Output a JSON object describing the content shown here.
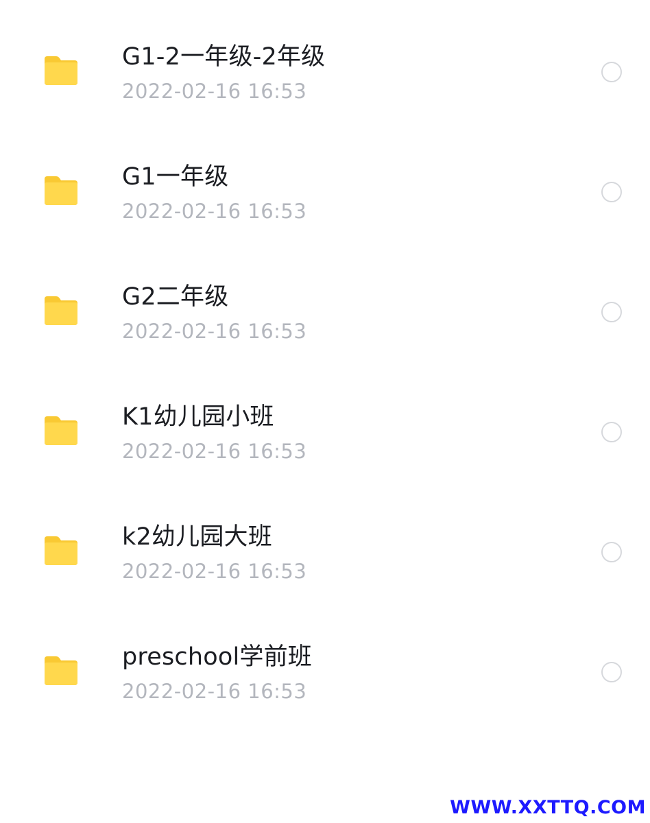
{
  "files": [
    {
      "name": "G1-2一年级-2年级",
      "date": "2022-02-16 16:53",
      "icon": "folder-icon",
      "selected": false
    },
    {
      "name": "G1一年级",
      "date": "2022-02-16 16:53",
      "icon": "folder-icon",
      "selected": false
    },
    {
      "name": "G2二年级",
      "date": "2022-02-16 16:53",
      "icon": "folder-icon",
      "selected": false
    },
    {
      "name": "K1幼儿园小班",
      "date": "2022-02-16 16:53",
      "icon": "folder-icon",
      "selected": false
    },
    {
      "name": "k2幼儿园大班",
      "date": "2022-02-16 16:53",
      "icon": "folder-icon",
      "selected": false
    },
    {
      "name": "preschool学前班",
      "date": "2022-02-16 16:53",
      "icon": "folder-icon",
      "selected": false
    }
  ],
  "watermark": "WWW.XXTTQ.COM",
  "colors": {
    "folder_body": "#FFD84D",
    "folder_tab": "#F9C933",
    "text_primary": "#1b1d22",
    "text_secondary": "#b3b6bd",
    "radio_border": "#d6d8dc",
    "watermark": "#1d1aff"
  }
}
